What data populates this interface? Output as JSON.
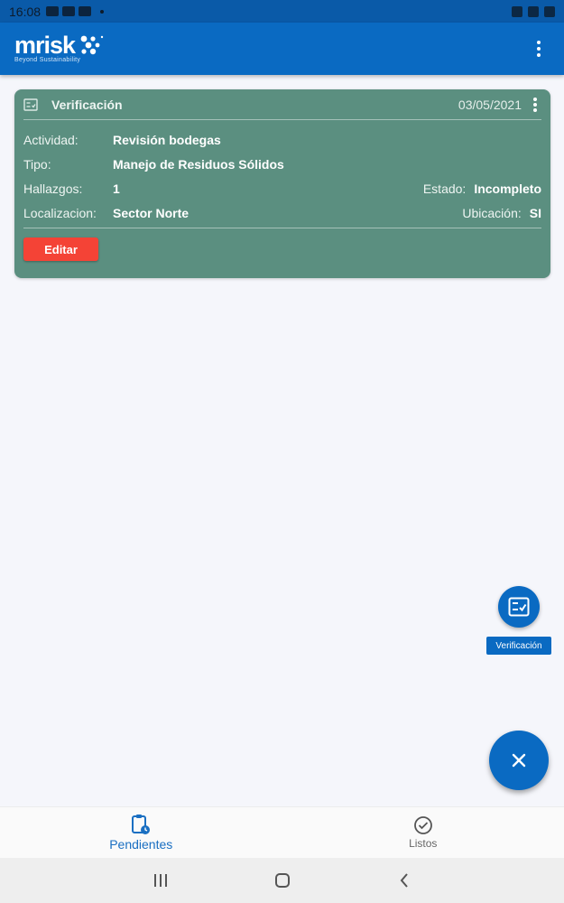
{
  "status_bar": {
    "time": "16:08"
  },
  "app_bar": {
    "logo_text": "mrisk",
    "logo_tagline": "Beyond Sustainability"
  },
  "card": {
    "title": "Verificación",
    "date": "03/05/2021",
    "fields": {
      "actividad_label": "Actividad:",
      "actividad_value": "Revisión bodegas",
      "tipo_label": "Tipo:",
      "tipo_value": "Manejo de Residuos Sólidos",
      "hallazgos_label": "Hallazgos:",
      "hallazgos_value": "1",
      "estado_label": "Estado:",
      "estado_value": "Incompleto",
      "localizacion_label": "Localizacion:",
      "localizacion_value": "Sector Norte",
      "ubicacion_label": "Ubicación:",
      "ubicacion_value": "SI"
    },
    "edit_label": "Editar"
  },
  "speed_dial": {
    "action_label": "Verificación",
    "fab_icon": "close-icon"
  },
  "bottom_nav": {
    "items": [
      {
        "label": "Pendientes",
        "icon": "clipboard-clock-icon",
        "active": true
      },
      {
        "label": "Listos",
        "icon": "check-circle-icon",
        "active": false
      }
    ]
  },
  "colors": {
    "primary": "#0a6ac2",
    "card_bg": "#5b8f80",
    "edit_button": "#f44336",
    "active_nav": "#1a6fc2"
  }
}
